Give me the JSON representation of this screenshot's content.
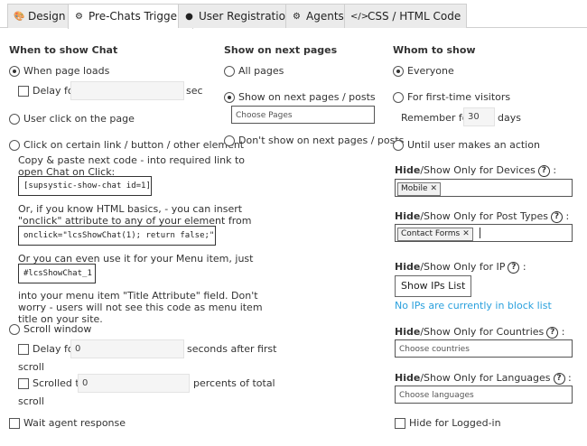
{
  "tabs": [
    {
      "label": "Design",
      "icon": "palette-icon"
    },
    {
      "label": "Pre-Chats Triggers",
      "icon": "gear-icon"
    },
    {
      "label": "User Registration",
      "icon": "user-icon"
    },
    {
      "label": "Agents",
      "icon": "agent-icon"
    },
    {
      "label": "CSS / HTML Code",
      "icon": "code-icon"
    }
  ],
  "when": {
    "title": "When to show Chat",
    "page_loads": "When page loads",
    "delay_for": "Delay for",
    "sec": "sec",
    "user_click": "User click on the page",
    "click_link": "Click on certain link / button / other element",
    "copy_paste": "Copy & paste next code - into required link to open Chat on Click:",
    "code1": "[supsystic-show-chat id=1]",
    "or_html": "Or, if you know HTML basics, - you can insert \"onclick\" attribute to any of your element from code below:",
    "code2": "onclick=\"lcsShowChat(1); return false;\"",
    "or_menu": "Or you can even use it for your Menu item, just add code:",
    "code3": "#lcsShowChat_1",
    "into_menu": "into your menu item \"Title Attribute\" field. Don't worry - users will not see this code as menu item title on your site.",
    "scroll_window": "Scroll window",
    "delay_label": "Delay for",
    "delay_value": "0",
    "seconds_after": "seconds after first",
    "scroll1": "scroll",
    "scrolled_to": "Scrolled to",
    "scrolled_value": "0",
    "percents": "percents of total",
    "scroll2": "scroll",
    "wait_agent": "Wait agent response"
  },
  "pages": {
    "title": "Show on next pages",
    "all_pages": "All pages",
    "show_next": "Show on next pages / posts",
    "choose_pages": "Choose Pages",
    "dont_show": "Don't show on next pages / posts"
  },
  "whom": {
    "title": "Whom to show",
    "everyone": "Everyone",
    "first_time": "For first-time visitors",
    "remember_for": "Remember for",
    "remember_value": "30",
    "days": "days",
    "until_action": "Until user makes an action",
    "hide_word": "Hide",
    "devices_rest": "/Show Only for Devices",
    "devices_tag": "Mobile",
    "post_types_rest": "/Show Only for Post Types",
    "post_types_tag": "Contact Forms",
    "ip_rest": "/Show Only for IP",
    "show_ips_btn": "Show IPs List",
    "no_ips": "No IPs are currently in block list",
    "countries_rest": "/Show Only for Countries",
    "countries_ph": "Choose countries",
    "languages_rest": "/Show Only for Languages",
    "languages_ph": "Choose languages",
    "hide_logged": "Hide for Logged-in",
    "colon": ":",
    "qmark": "?",
    "remove_x": "✕"
  }
}
